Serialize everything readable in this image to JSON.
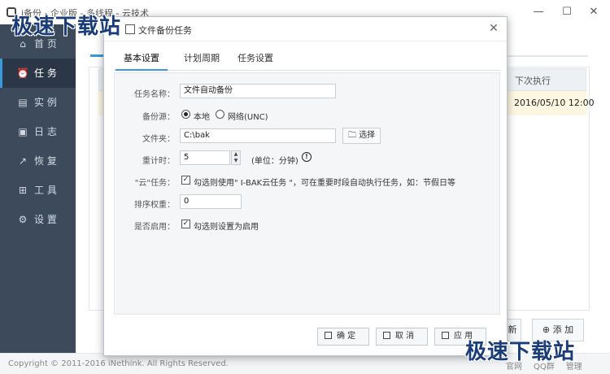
{
  "app": {
    "title": "i备份 - 企业版 - 多线程 - 云技术",
    "minimize_icon": "minimize-icon",
    "maximize_icon": "maximize-icon",
    "close_icon": "close-icon"
  },
  "watermark": {
    "text": "极速下载站"
  },
  "sidebar": {
    "items": [
      {
        "label": "首 页",
        "icon": "home-icon"
      },
      {
        "label": "任 务",
        "icon": "alarm-clock-icon"
      },
      {
        "label": "实 例",
        "icon": "database-icon"
      },
      {
        "label": "日 志",
        "icon": "log-icon"
      },
      {
        "label": "恢 复",
        "icon": "restore-icon"
      },
      {
        "label": "工 具",
        "icon": "tools-icon"
      },
      {
        "label": "设 置",
        "icon": "gear-icon"
      }
    ],
    "active_index": 1
  },
  "main": {
    "table": {
      "columns": [
        "下次执行"
      ],
      "rows": [
        {
          "next_run": "2016/05/10 12:00"
        }
      ]
    },
    "buttons": {
      "refresh": "新",
      "add": "添 加"
    }
  },
  "footer": {
    "copyright": "Copyright © 2011-2016 iNethink. All Rights Reserved.",
    "links": [
      "官网",
      "QQ群",
      "管理"
    ]
  },
  "dialog": {
    "title": "文件备份任务",
    "tabs": [
      "基本设置",
      "计划周期",
      "任务设置"
    ],
    "active_tab": 0,
    "form": {
      "task_name": {
        "label": "任务名称：",
        "value": "文件自动备份"
      },
      "backup_source": {
        "label": "备份源：",
        "options": [
          "本地",
          "网络(UNC)"
        ],
        "selected": "本地"
      },
      "folder": {
        "label": "文件夹：",
        "value": "C:\\bak",
        "browse_label": "选择"
      },
      "timer": {
        "label": "重计时：",
        "value": "5",
        "unit": "(单位：分钟)"
      },
      "cloud_task": {
        "label": "\"云\"任务：",
        "checked": true,
        "text": "勾选则使用\" I-BAK云任务 \"，可在重要时段自动执行任务，如：节假日等"
      },
      "priority": {
        "label": "排序权重：",
        "value": "0"
      },
      "enabled": {
        "label": "是否启用：",
        "checked": true,
        "text": "勾选则设置为启用"
      }
    },
    "buttons": {
      "ok": "确 定",
      "cancel": "取 消",
      "apply": "应 用"
    }
  },
  "colors": {
    "sidebar_bg": "#3c4a5c",
    "sidebar_active_bg": "#2b3746",
    "accent": "#3a9ad9",
    "highlight_row": "#fdf7e2"
  }
}
